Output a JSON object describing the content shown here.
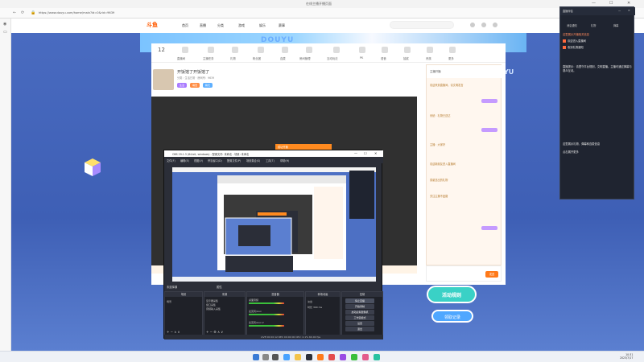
{
  "browser": {
    "window_title": "在线主播开播页面",
    "url": "https://www.douyu.com/home/main?id=0&rid=9639",
    "minimize": "—",
    "maximize": "☐",
    "close": "✕"
  },
  "site": {
    "logo": "斗鱼",
    "nav": [
      "首页",
      "直播",
      "分类",
      "游戏",
      "娱乐",
      "赛事"
    ],
    "banner_text": "DOUYU",
    "banner_side": "YU"
  },
  "icon_row": {
    "count": "12",
    "labels": [
      "直播间",
      "主播任务",
      "礼物",
      "粉丝团",
      "连麦",
      "房间管理",
      "互动玩法",
      "PK",
      "语音",
      "抽奖",
      "贵族",
      "更多"
    ]
  },
  "stream_head": {
    "title": "开饭馆了开饭馆了",
    "meta": "分类：生活日常 · 房间号：9639",
    "tags": [
      "生活",
      "萌宠",
      "聊天"
    ]
  },
  "chat": {
    "header": "主播开播",
    "lines": [
      "欢迎来到直播间，请文明发言",
      "系统：礼物已送达",
      "主播：大家好",
      "欢迎新朋友进入直播间",
      "感谢送出的礼物",
      "关注主播不迷路"
    ],
    "send": "发送"
  },
  "notice": "成功开播",
  "activity": {
    "button": "活动规则",
    "record": "领取记录"
  },
  "obs": {
    "title": "OBS 29.1.3 (64-bit, windows) - 配置文件: 未命名 - 场景: 未命名",
    "menu": [
      "文件(F)",
      "编辑(E)",
      "视图(V)",
      "停靠窗口(D)",
      "配置文件(P)",
      "场景集合(S)",
      "工具(T)",
      "帮助(H)"
    ],
    "scene_label": "未选择源",
    "studio": "属性",
    "docks": {
      "scenes": {
        "header": "场景",
        "items": [
          "场景"
        ]
      },
      "sources": {
        "header": "来源",
        "items": [
          "显示器采集",
          "窗口采集",
          "音频输入采集"
        ]
      },
      "mixer": {
        "header": "混音器",
        "items": [
          "桌面音频",
          "麦克风/Aux",
          "麦克风/Aux 2"
        ]
      },
      "transitions": {
        "header": "转场动画",
        "items": [
          "淡出",
          "时长 300 ms"
        ]
      },
      "controls": {
        "header": "控制",
        "items": [
          "停止直播",
          "开始录制",
          "启动虚拟摄像机",
          "工作室模式",
          "设置",
          "退出"
        ]
      }
    },
    "status": "LIVE 00:00:12   REC 00:00:00   CPU: 2.1%  60.00 fps"
  },
  "right_panel": {
    "title": "直播伴侣",
    "tabs": [
      "消息通知",
      "礼物",
      "弹幕"
    ],
    "messages": [
      "这里展示开播相关信息",
      "欢迎进入直播间",
      "收到礼物通知",
      "直播提示：请遵守平台规则，文明直播。主播可通过弹幕与观众互动。",
      "这里展示礼物、弹幕和连麦信息",
      "点击展开更多"
    ]
  },
  "taskbar": {
    "time": "10:31",
    "date": "2023/7/17"
  },
  "colors": {
    "accent": "#ff7a1a",
    "page_bg": "#4a6cc1",
    "obs_bg": "#2b2e38",
    "panel_bg": "#1f2430"
  }
}
